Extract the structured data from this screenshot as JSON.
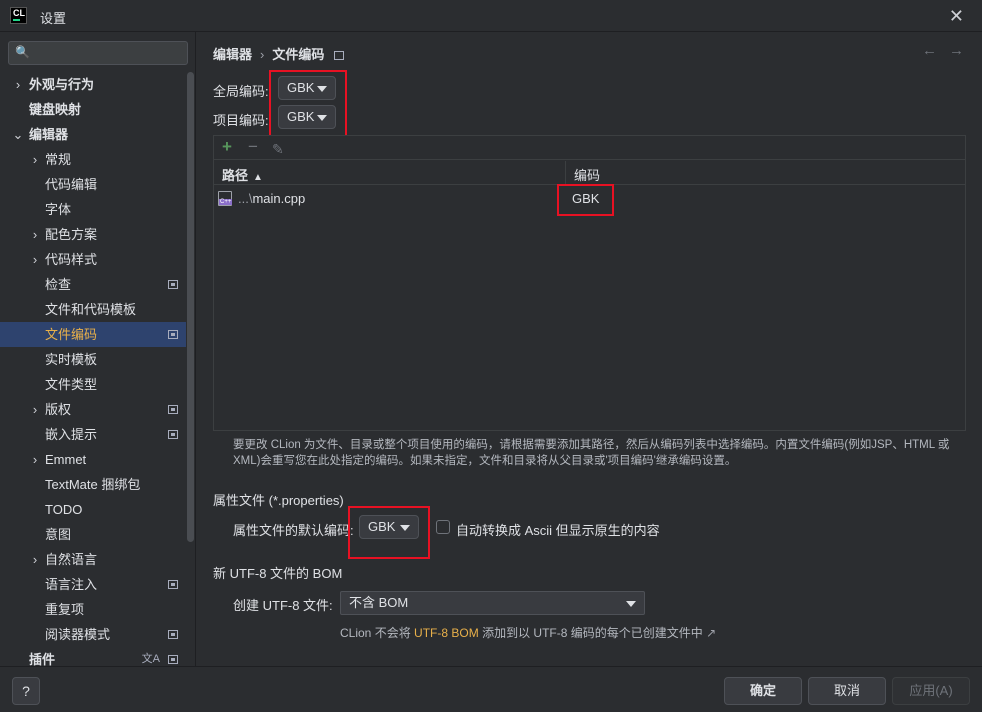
{
  "window": {
    "logo_text": "CL",
    "title": "设置",
    "close_glyph": "✕"
  },
  "sidebar": {
    "search_placeholder": "",
    "search_icon": "🔍",
    "items": [
      {
        "label": "外观与行为",
        "bold": true,
        "chevron": "›",
        "badge": false
      },
      {
        "label": "键盘映射",
        "bold": true,
        "chevron": "",
        "badge": false
      },
      {
        "label": "编辑器",
        "bold": true,
        "chevron": "⌄",
        "badge": false
      },
      {
        "label": "常规",
        "bold": false,
        "chevron": "›",
        "badge": false
      },
      {
        "label": "代码编辑",
        "bold": false,
        "chevron": "",
        "badge": false
      },
      {
        "label": "字体",
        "bold": false,
        "chevron": "",
        "badge": false
      },
      {
        "label": "配色方案",
        "bold": false,
        "chevron": "›",
        "badge": false
      },
      {
        "label": "代码样式",
        "bold": false,
        "chevron": "›",
        "badge": false
      },
      {
        "label": "检查",
        "bold": false,
        "chevron": "",
        "badge": true
      },
      {
        "label": "文件和代码模板",
        "bold": false,
        "chevron": "",
        "badge": false
      },
      {
        "label": "文件编码",
        "bold": false,
        "chevron": "",
        "badge": true,
        "selected": true
      },
      {
        "label": "实时模板",
        "bold": false,
        "chevron": "",
        "badge": false
      },
      {
        "label": "文件类型",
        "bold": false,
        "chevron": "",
        "badge": false
      },
      {
        "label": "版权",
        "bold": false,
        "chevron": "›",
        "badge": true
      },
      {
        "label": "嵌入提示",
        "bold": false,
        "chevron": "",
        "badge": true
      },
      {
        "label": "Emmet",
        "bold": false,
        "chevron": "›",
        "badge": false
      },
      {
        "label": "TextMate 捆绑包",
        "bold": false,
        "chevron": "",
        "badge": false
      },
      {
        "label": "TODO",
        "bold": false,
        "chevron": "",
        "badge": false
      },
      {
        "label": "意图",
        "bold": false,
        "chevron": "",
        "badge": false
      },
      {
        "label": "自然语言",
        "bold": false,
        "chevron": "›",
        "badge": false
      },
      {
        "label": "语言注入",
        "bold": false,
        "chevron": "",
        "badge": true
      },
      {
        "label": "重复项",
        "bold": false,
        "chevron": "",
        "badge": false
      },
      {
        "label": "阅读器模式",
        "bold": false,
        "chevron": "",
        "badge": true
      },
      {
        "label": "插件",
        "bold": true,
        "chevron": "",
        "badge": true,
        "lang": "文A"
      }
    ]
  },
  "main": {
    "breadcrumb": {
      "parent": "编辑器",
      "sep": "›",
      "current": "文件编码"
    },
    "nav": {
      "back": "←",
      "forward": "→"
    },
    "global_encoding": {
      "label": "全局编码:",
      "value": "GBK"
    },
    "project_encoding": {
      "label": "项目编码:",
      "value": "GBK"
    },
    "toolbar": {
      "add": "+",
      "remove": "−",
      "edit": "✎"
    },
    "table": {
      "col_path": "路径",
      "sort_glyph": "▲",
      "col_encoding": "编码",
      "rows": [
        {
          "path_prefix": "...\\",
          "path": "main.cpp",
          "encoding": "GBK"
        }
      ]
    },
    "description": "要更改 CLion 为文件、目录或整个项目使用的编码，请根据需要添加其路径，然后从编码列表中选择编码。内置文件编码(例如JSP、HTML 或 XML)会重写您在此处指定的编码。如果未指定，文件和目录将从父目录或'项目编码'继承编码设置。",
    "properties": {
      "section_title": "属性文件 (*.properties)",
      "default_label": "属性文件的默认编码:",
      "default_value": "GBK",
      "ascii_label": "自动转换成 Ascii 但显示原生的内容",
      "ascii_checked": false
    },
    "bom": {
      "section_title": "新 UTF-8 文件的 BOM",
      "create_label": "创建 UTF-8 文件:",
      "create_value": "不含 BOM",
      "hint_prefix": "CLion 不会将",
      "hint_link": "UTF-8 BOM",
      "hint_suffix": "添加到以 UTF-8 编码的每个已创建文件中",
      "hint_ext": "↗"
    }
  },
  "footer": {
    "help": "?",
    "ok": "确定",
    "cancel": "取消",
    "apply": "应用(A)"
  }
}
